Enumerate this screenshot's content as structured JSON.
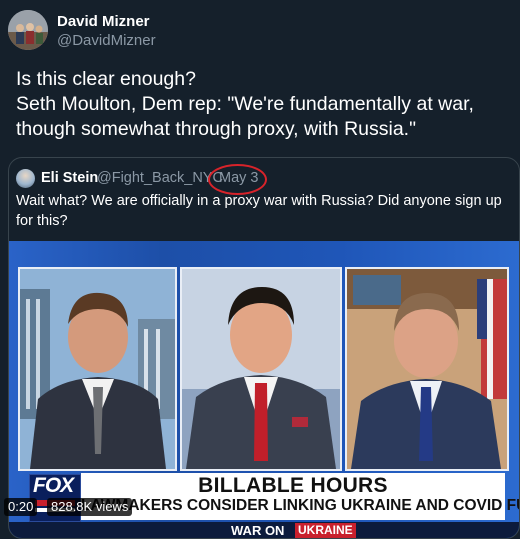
{
  "author": {
    "display_name": "David Mizner",
    "handle": "@DavidMizner"
  },
  "tweet": {
    "text": "Is this clear enough?\nSeth Moulton, Dem rep: \"We're fundamentally at war, though somewhat through proxy, with Russia.\""
  },
  "quoted_tweet": {
    "display_name": "Eli Stein",
    "handle": "@Fight_Back_NYC",
    "date": "May 3",
    "text": "Wait what? We are officially in a proxy war with Russia? Did anyone sign up for this?"
  },
  "video": {
    "network": "FOX",
    "headline": "BILLABLE HOURS",
    "subheadline": "LAWMAKERS CONSIDER LINKING UKRAINE AND COVID FUNDING",
    "ticker_prefix": "WAR ON",
    "ticker_tag": "UKRAINE",
    "time": "0:20",
    "views": "828.8K views"
  },
  "colors": {
    "background": "#15202b",
    "secondary_text": "#8b98a5",
    "annotation_circle": "#d8232a",
    "fox_red": "#c9202d"
  }
}
